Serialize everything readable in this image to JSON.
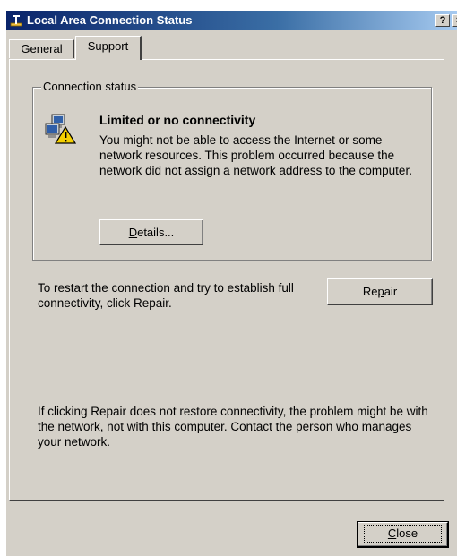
{
  "window": {
    "title": "Local Area Connection Status",
    "help_button": "?",
    "close_button": "×"
  },
  "tabs": [
    {
      "label": "General",
      "selected": false
    },
    {
      "label": "Support",
      "selected": true
    }
  ],
  "connection_status": {
    "group_label": "Connection status",
    "title": "Limited or no connectivity",
    "description": "You might not be able to access the Internet or some network resources. This problem occurred because the network did not assign a network address to the computer.",
    "details_button": {
      "prefix": "",
      "accel": "D",
      "suffix": "etails..."
    },
    "icon": "network-warning-icon"
  },
  "repair": {
    "text": "To restart the connection and try to establish full connectivity, click Repair.",
    "button": {
      "prefix": "Re",
      "accel": "p",
      "suffix": "air"
    }
  },
  "note": "If clicking Repair does not restore connectivity, the problem might be with the network, not with this computer. Contact the person who manages your network.",
  "close_button": {
    "prefix": "",
    "accel": "C",
    "suffix": "lose"
  },
  "colors": {
    "title_bar_start": "#0a246a",
    "title_bar_end": "#a6caf0",
    "dialog_face": "#d4d0c8"
  }
}
